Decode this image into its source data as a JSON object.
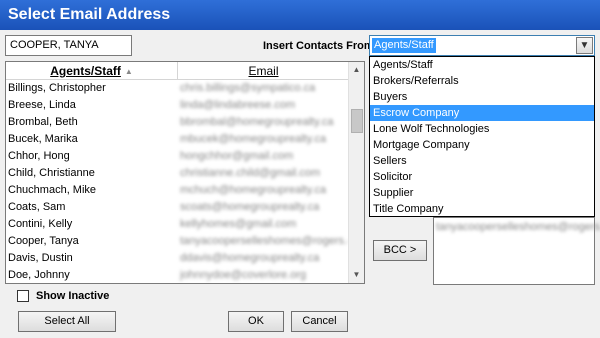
{
  "window": {
    "title": "Select Email Address"
  },
  "name_field": {
    "value": "COOPER, TANYA"
  },
  "insert_contacts": {
    "label": "Insert Contacts From:",
    "selected": "Agents/Staff",
    "options": [
      "Agents/Staff",
      "Brokers/Referrals",
      "Buyers",
      "Escrow Company",
      "Lone Wolf Technologies",
      "Mortgage Company",
      "Sellers",
      "Solicitor",
      "Supplier",
      "Title Company"
    ],
    "highlighted": "Escrow Company"
  },
  "contacts_table": {
    "columns": [
      "Agents/Staff",
      "Email"
    ],
    "rows": [
      {
        "name": "Billings, Christopher",
        "email": "chris.billings@sympatico.ca"
      },
      {
        "name": "Breese, Linda",
        "email": "linda@lindabreese.com"
      },
      {
        "name": "Brombal, Beth",
        "email": "bbrombal@homegrouprealty.ca"
      },
      {
        "name": "Bucek, Marika",
        "email": "mbucek@homegrouprealty.ca"
      },
      {
        "name": "Chhor, Hong",
        "email": "hongchhor@gmail.com"
      },
      {
        "name": "Child, Christianne",
        "email": "christianne.child@gmail.com"
      },
      {
        "name": "Chuchmach, Mike",
        "email": "mchuch@homegrouprealty.ca"
      },
      {
        "name": "Coats, Sam",
        "email": "scoats@homegrouprealty.ca"
      },
      {
        "name": "Contini, Kelly",
        "email": "kellyhomes@gmail.com"
      },
      {
        "name": "Cooper, Tanya",
        "email": "tanyacooperselleshomes@rogers.com"
      },
      {
        "name": "Davis, Dustin",
        "email": "ddavis@homegrouprealty.ca"
      },
      {
        "name": "Doe, Johnny",
        "email": "johnnydoe@coverlore.org"
      }
    ]
  },
  "bcc": {
    "button_label": "BCC >",
    "value": "tanyacooperselleshomes@rogers.com"
  },
  "show_inactive": {
    "label": "Show Inactive",
    "checked": false
  },
  "buttons": {
    "select_all": "Select All",
    "ok": "OK",
    "cancel": "Cancel"
  }
}
